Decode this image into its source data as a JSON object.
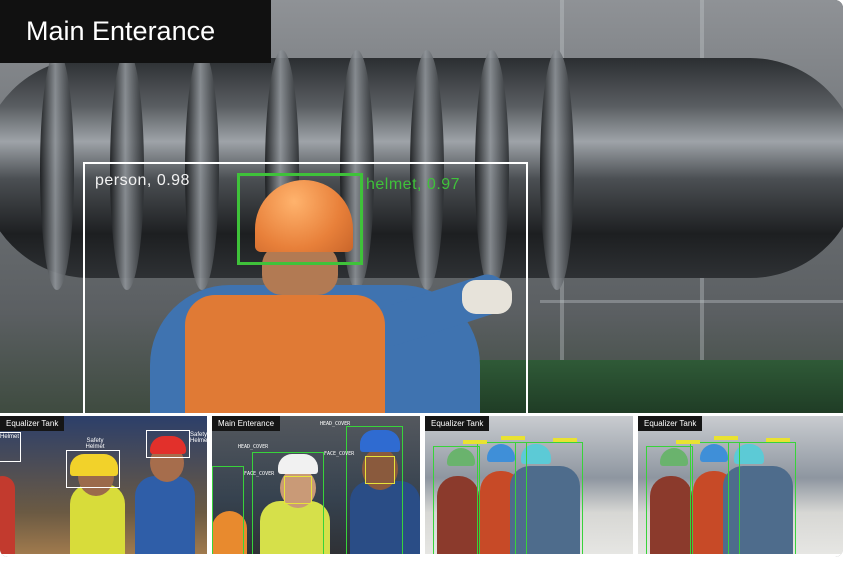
{
  "main_feed": {
    "title": "Main Enterance",
    "detections": [
      {
        "label": "person, 0.98",
        "color": "#ffffff"
      },
      {
        "label": "helmet, 0.97",
        "color": "#3fc23a"
      }
    ]
  },
  "thumbnails": [
    {
      "title": "Equalizer Tank",
      "labels": [
        "Helmet",
        "Safety Helmet",
        "Safety Helmet"
      ]
    },
    {
      "title": "Main Enterance",
      "labels": [
        "HEAD_COVER",
        "HEAD_COVER",
        "FACE_COVER",
        "FACE_COVER"
      ]
    },
    {
      "title": "Equalizer Tank"
    },
    {
      "title": "Equalizer Tank"
    }
  ],
  "colors": {
    "title_bg": "#111111",
    "detection_green": "#3fc23a",
    "accent_orange": "#e07a35"
  }
}
